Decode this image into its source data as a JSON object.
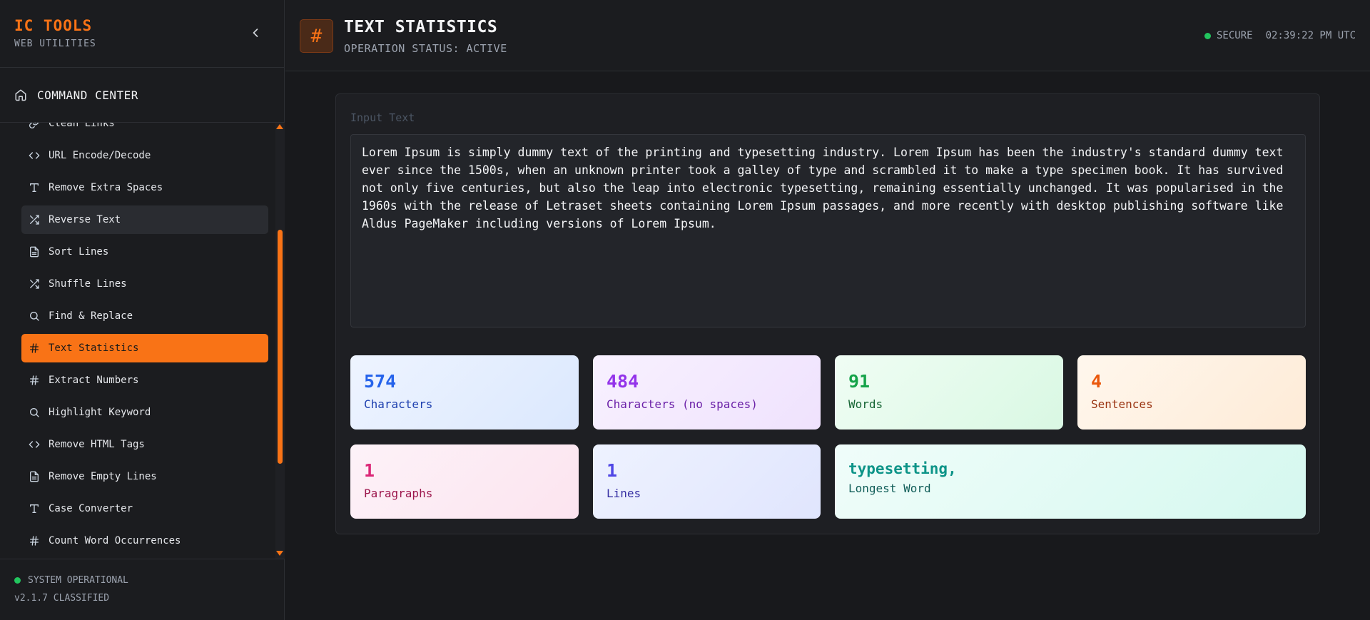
{
  "sidebar": {
    "brand_title": "IC TOOLS",
    "brand_sub": "WEB UTILITIES",
    "command_center": "COMMAND CENTER",
    "items": [
      {
        "label": "Clean Links",
        "icon": "link-icon"
      },
      {
        "label": "URL Encode/Decode",
        "icon": "code-icon"
      },
      {
        "label": "Remove Extra Spaces",
        "icon": "type-icon"
      },
      {
        "label": "Reverse Text",
        "icon": "shuffle-icon"
      },
      {
        "label": "Sort Lines",
        "icon": "file-icon"
      },
      {
        "label": "Shuffle Lines",
        "icon": "shuffle-icon"
      },
      {
        "label": "Find & Replace",
        "icon": "search-icon"
      },
      {
        "label": "Text Statistics",
        "icon": "hash-icon"
      },
      {
        "label": "Extract Numbers",
        "icon": "hash-icon"
      },
      {
        "label": "Highlight Keyword",
        "icon": "search-icon"
      },
      {
        "label": "Remove HTML Tags",
        "icon": "code-icon"
      },
      {
        "label": "Remove Empty Lines",
        "icon": "file-icon"
      },
      {
        "label": "Case Converter",
        "icon": "type-icon"
      },
      {
        "label": "Count Word Occurrences",
        "icon": "hash-icon"
      }
    ],
    "active_item": "Text Statistics",
    "hover_item": "Reverse Text",
    "system_status": "SYSTEM OPERATIONAL",
    "version": "v2.1.7 CLASSIFIED"
  },
  "header": {
    "icon": "#",
    "title": "TEXT STATISTICS",
    "status": "OPERATION STATUS: ACTIVE",
    "secure": "SECURE",
    "time": "02:39:22 PM UTC"
  },
  "main": {
    "input_placeholder": "Input Text",
    "input_value": "Lorem Ipsum is simply dummy text of the printing and typesetting industry. Lorem Ipsum has been the industry's standard dummy text ever since the 1500s, when an unknown printer took a galley of type and scrambled it to make a type specimen book. It has survived not only five centuries, but also the leap into electronic typesetting, remaining essentially unchanged. It was popularised in the 1960s with the release of Letraset sheets containing Lorem Ipsum passages, and more recently with desktop publishing software like Aldus PageMaker including versions of Lorem Ipsum.",
    "stats": [
      {
        "value": "574",
        "label": "Characters"
      },
      {
        "value": "484",
        "label": "Characters (no spaces)"
      },
      {
        "value": "91",
        "label": "Words"
      },
      {
        "value": "4",
        "label": "Sentences"
      },
      {
        "value": "1",
        "label": "Paragraphs"
      },
      {
        "value": "1",
        "label": "Lines"
      },
      {
        "value": "typesetting,",
        "label": "Longest Word"
      }
    ]
  },
  "colors": {
    "accent": "#f97316",
    "status_green": "#22c55e",
    "blue": "#2563eb",
    "purple": "#9333ea",
    "green": "#16a34a",
    "orange": "#ea580c",
    "pink": "#db2777",
    "indigo": "#4f46e5",
    "teal": "#0d9488"
  }
}
